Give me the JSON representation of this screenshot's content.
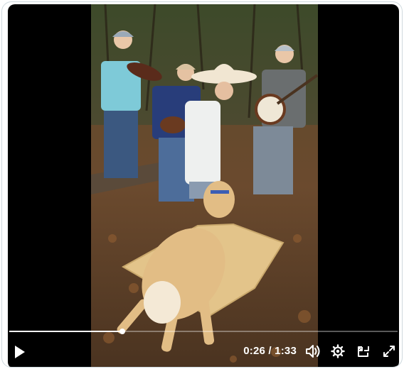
{
  "player": {
    "progress": 0.292,
    "time": {
      "current": "0:26",
      "separator": " / ",
      "duration": "1:33"
    },
    "icons": {
      "play": "play-icon",
      "volume": "volume-icon",
      "settings": "gear-icon",
      "popout": "popout-icon",
      "fullscreen": "fullscreen-icon"
    }
  },
  "colors": {
    "letterbox": "#000000",
    "control_icon": "#ffffff",
    "scrubber_track": "rgba(255,255,255,0.35)",
    "scrubber_fill": "#ffffff"
  }
}
